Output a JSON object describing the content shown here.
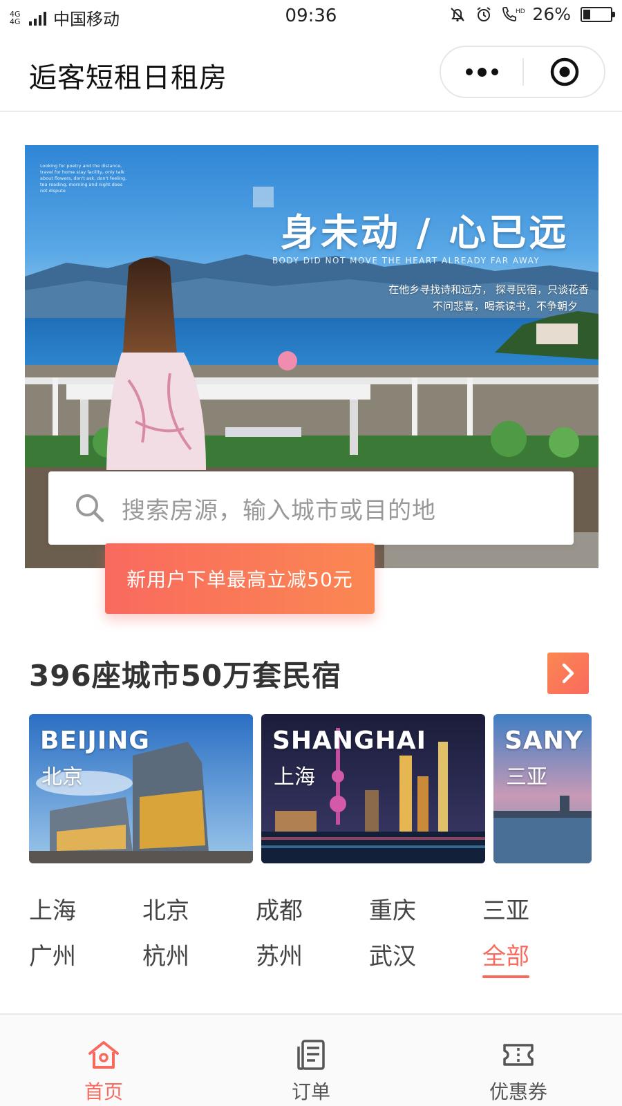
{
  "status_bar": {
    "network": "4G 4G",
    "carrier": "中国移动",
    "time": "09:36",
    "battery_pct": "26%",
    "battery_level": 0.26,
    "icons": [
      "silent-bell-icon",
      "alarm-icon",
      "hd-call-icon"
    ]
  },
  "header": {
    "title": "逅客短租日租房",
    "more_icon": "more-dots-icon",
    "close_icon": "target-close-icon"
  },
  "banner": {
    "small_text": "Looking for poetry and the distance, travel for home stay facility, only talk about flowers, don't ask, don't feeling, tea reading, morning and night does not dispute",
    "headline": "身未动 / 心已远",
    "subtitle_en": "BODY DID NOT MOVE THE HEART ALREADY FAR AWAY",
    "line1": "在他乡寻找诗和远方，  探寻民宿，只谈花香",
    "line2": "不问悲喜，喝茶读书，不争朝夕"
  },
  "search": {
    "placeholder": "搜索房源，输入城市或目的地"
  },
  "promo": {
    "text": "新用户下单最高立减50元"
  },
  "section": {
    "title": "396座城市50万套民宿"
  },
  "city_cards": [
    {
      "en": "BEIJING",
      "cn": "北京"
    },
    {
      "en": "SHANGHAI",
      "cn": "上海"
    },
    {
      "en": "SANY",
      "cn": "三亚"
    }
  ],
  "city_grid": [
    [
      "上海",
      "北京",
      "成都",
      "重庆",
      "三亚"
    ],
    [
      "广州",
      "杭州",
      "苏州",
      "武汉",
      "全部"
    ]
  ],
  "tabs": [
    {
      "label": "首页",
      "icon": "home-icon",
      "active": true
    },
    {
      "label": "订单",
      "icon": "order-list-icon",
      "active": false
    },
    {
      "label": "优惠券",
      "icon": "coupon-icon",
      "active": false
    }
  ],
  "colors": {
    "accent": "#f96a5e",
    "accent_gradient_end": "#fb8752"
  }
}
